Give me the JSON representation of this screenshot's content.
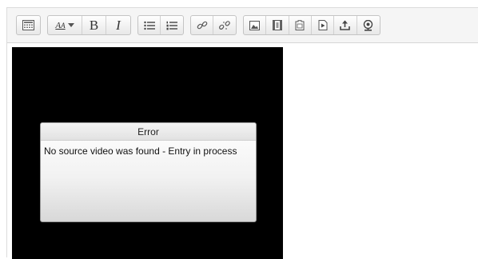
{
  "toolbar": {
    "groups": [
      {
        "name": "toolbar-toggle",
        "buttons": [
          {
            "icon": "toolbar-toggle-icon",
            "tooltip": ""
          }
        ]
      },
      {
        "name": "text-style",
        "buttons": [
          {
            "icon": "font-size-icon",
            "glyph": "A",
            "tooltip": ""
          },
          {
            "icon": "bold-icon",
            "glyph": "B",
            "tooltip": ""
          },
          {
            "icon": "italic-icon",
            "glyph": "I",
            "tooltip": ""
          }
        ]
      },
      {
        "name": "lists",
        "buttons": [
          {
            "icon": "unordered-list-icon",
            "tooltip": ""
          },
          {
            "icon": "ordered-list-icon",
            "tooltip": ""
          }
        ]
      },
      {
        "name": "links",
        "buttons": [
          {
            "icon": "link-icon",
            "tooltip": ""
          },
          {
            "icon": "unlink-icon",
            "tooltip": ""
          }
        ]
      },
      {
        "name": "media",
        "buttons": [
          {
            "icon": "image-icon",
            "tooltip": ""
          },
          {
            "icon": "media-icon",
            "tooltip": ""
          },
          {
            "icon": "manage-files-icon",
            "tooltip": ""
          },
          {
            "icon": "video-embed-icon",
            "tooltip": ""
          },
          {
            "icon": "upload-icon",
            "tooltip": ""
          },
          {
            "icon": "webcam-icon",
            "tooltip": ""
          }
        ]
      }
    ],
    "bold_glyph": "B",
    "italic_glyph": "I",
    "font_glyph": "A"
  },
  "player": {
    "dialog_title": "Error",
    "dialog_message": "No source video was found - Entry in process"
  },
  "colors": {
    "toolbar_bg": "#f5f5f5",
    "player_bg": "#000000",
    "dialog_border": "#9a9a9a"
  }
}
